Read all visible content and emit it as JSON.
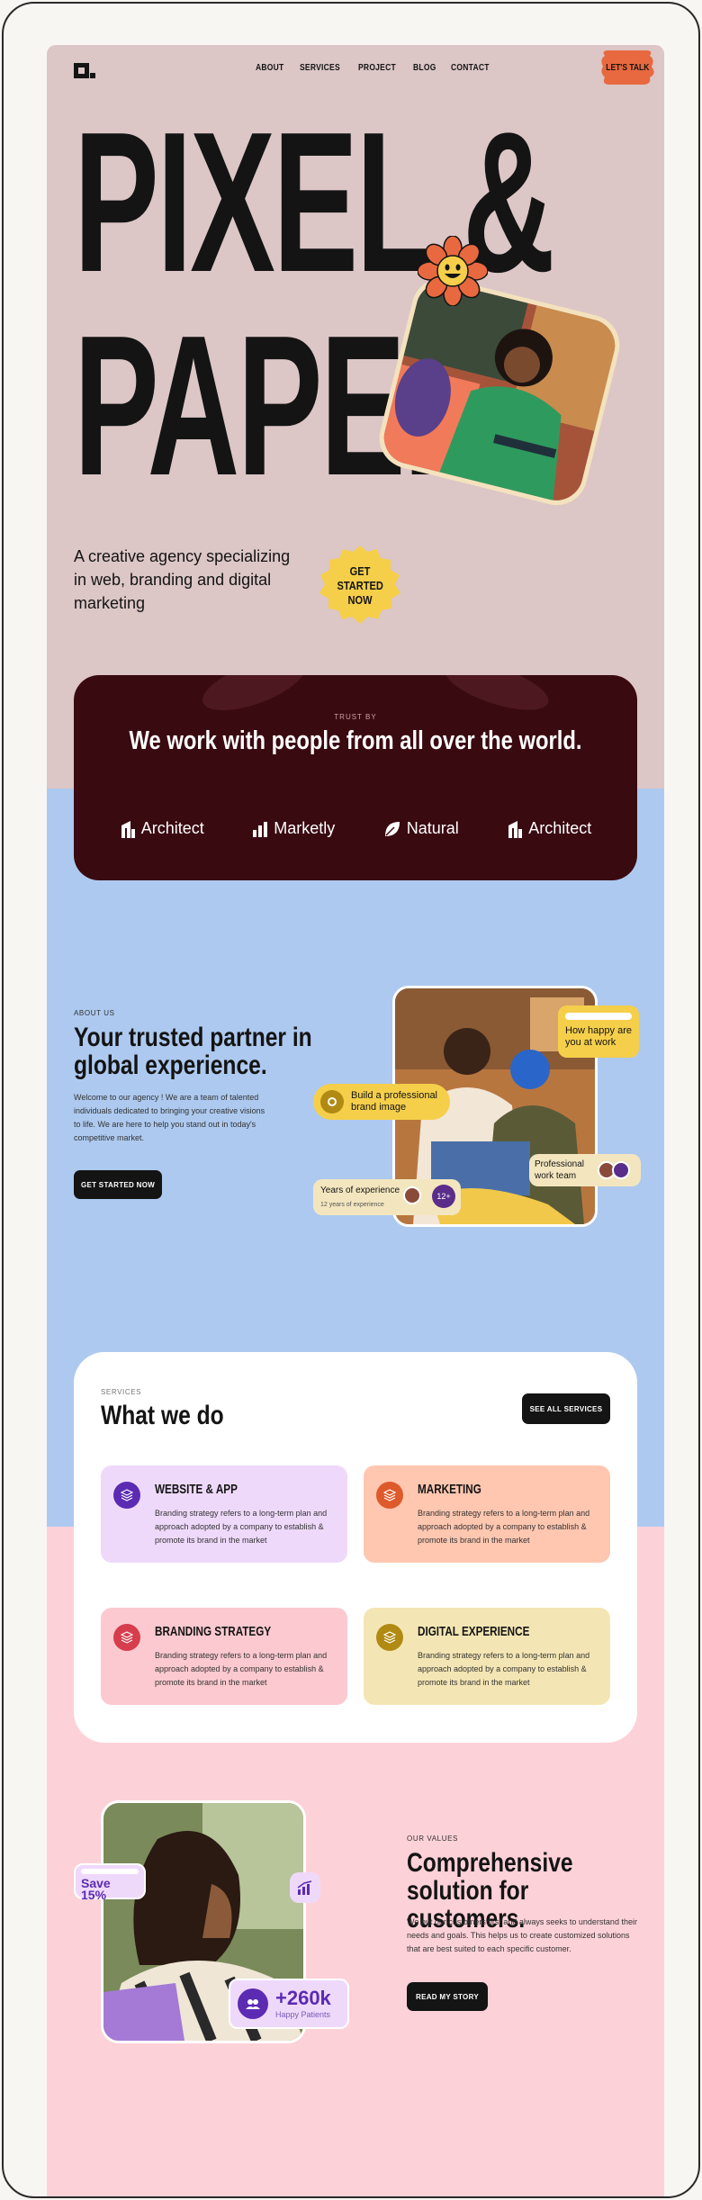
{
  "nav": {
    "items": [
      "ABOUT",
      "SERVICES",
      "PROJECT",
      "BLOG",
      "CONTACT"
    ],
    "cta": "LET'S TALK"
  },
  "hero": {
    "line1": "PIXEL &",
    "line2": "PAPER",
    "subtitle": "A creative agency specializing in web, branding and digital marketing",
    "cta": "GET STARTED NOW"
  },
  "trust": {
    "label": "TRUST BY",
    "heading": "We work with people from all over the world.",
    "brands": [
      "Architect",
      "Marketly",
      "Natural",
      "Architect"
    ]
  },
  "about": {
    "label": "ABOUT US",
    "heading": "Your trusted partner in global experience.",
    "text": "Welcome to our agency ! We are a team of talented individuals dedicated to bringing your creative visions to life. We are here to help you stand out in today's competitive market.",
    "cta": "GET STARTED NOW",
    "badge_happy": "How happy are you at work",
    "badge_brand": "Build a professional brand image",
    "badge_team": "Professional work team",
    "badge_years_title": "Years of experience",
    "badge_years_sub": "12 years of experience",
    "badge_years_count": "12+"
  },
  "services": {
    "label": "SERVICES",
    "heading": "What we do",
    "cta": "SEE ALL SERVICES",
    "cards": [
      {
        "title": "WEBSITE & APP",
        "text": "Branding strategy refers to a long-term plan and approach adopted by a company to establish & promote its brand in the market",
        "bg": "#efd9fb",
        "icon": "#5b2bb3"
      },
      {
        "title": "MARKETING",
        "text": "Branding strategy refers to a long-term plan and approach adopted by a company to establish & promote its brand in the market",
        "bg": "#ffc7b0",
        "icon": "#dd5a2b"
      },
      {
        "title": "BRANDING STRATEGY",
        "text": "Branding strategy refers to a long-term plan and approach adopted by a company to establish & promote its brand in the market",
        "bg": "#fbc9cf",
        "icon": "#d63d4d"
      },
      {
        "title": "DIGITAL EXPERIENCE",
        "text": "Branding strategy refers to a long-term plan and approach adopted by a company to establish & promote its brand in the market",
        "bg": "#f4e6b4",
        "icon": "#b08a12"
      }
    ]
  },
  "values": {
    "label": "OUR VALUES",
    "heading": "Comprehensive solution for customers.",
    "text": "We put our customers first and always seeks to understand their needs and goals. This helps us to create customized solutions that are best suited to each specific customer.",
    "cta": "READ MY STORY",
    "save_badge": "Save 15%",
    "patients_count": "+260k",
    "patients_label": "Happy Patients"
  },
  "colors": {
    "hero_bg": "#dcc6c6",
    "trust_bg": "#3a0a11",
    "blue_bg": "#adc9ef",
    "pink_bg": "#fdd1d8",
    "accent_yellow": "#f5cf4a",
    "accent_orange": "#e8693f"
  }
}
